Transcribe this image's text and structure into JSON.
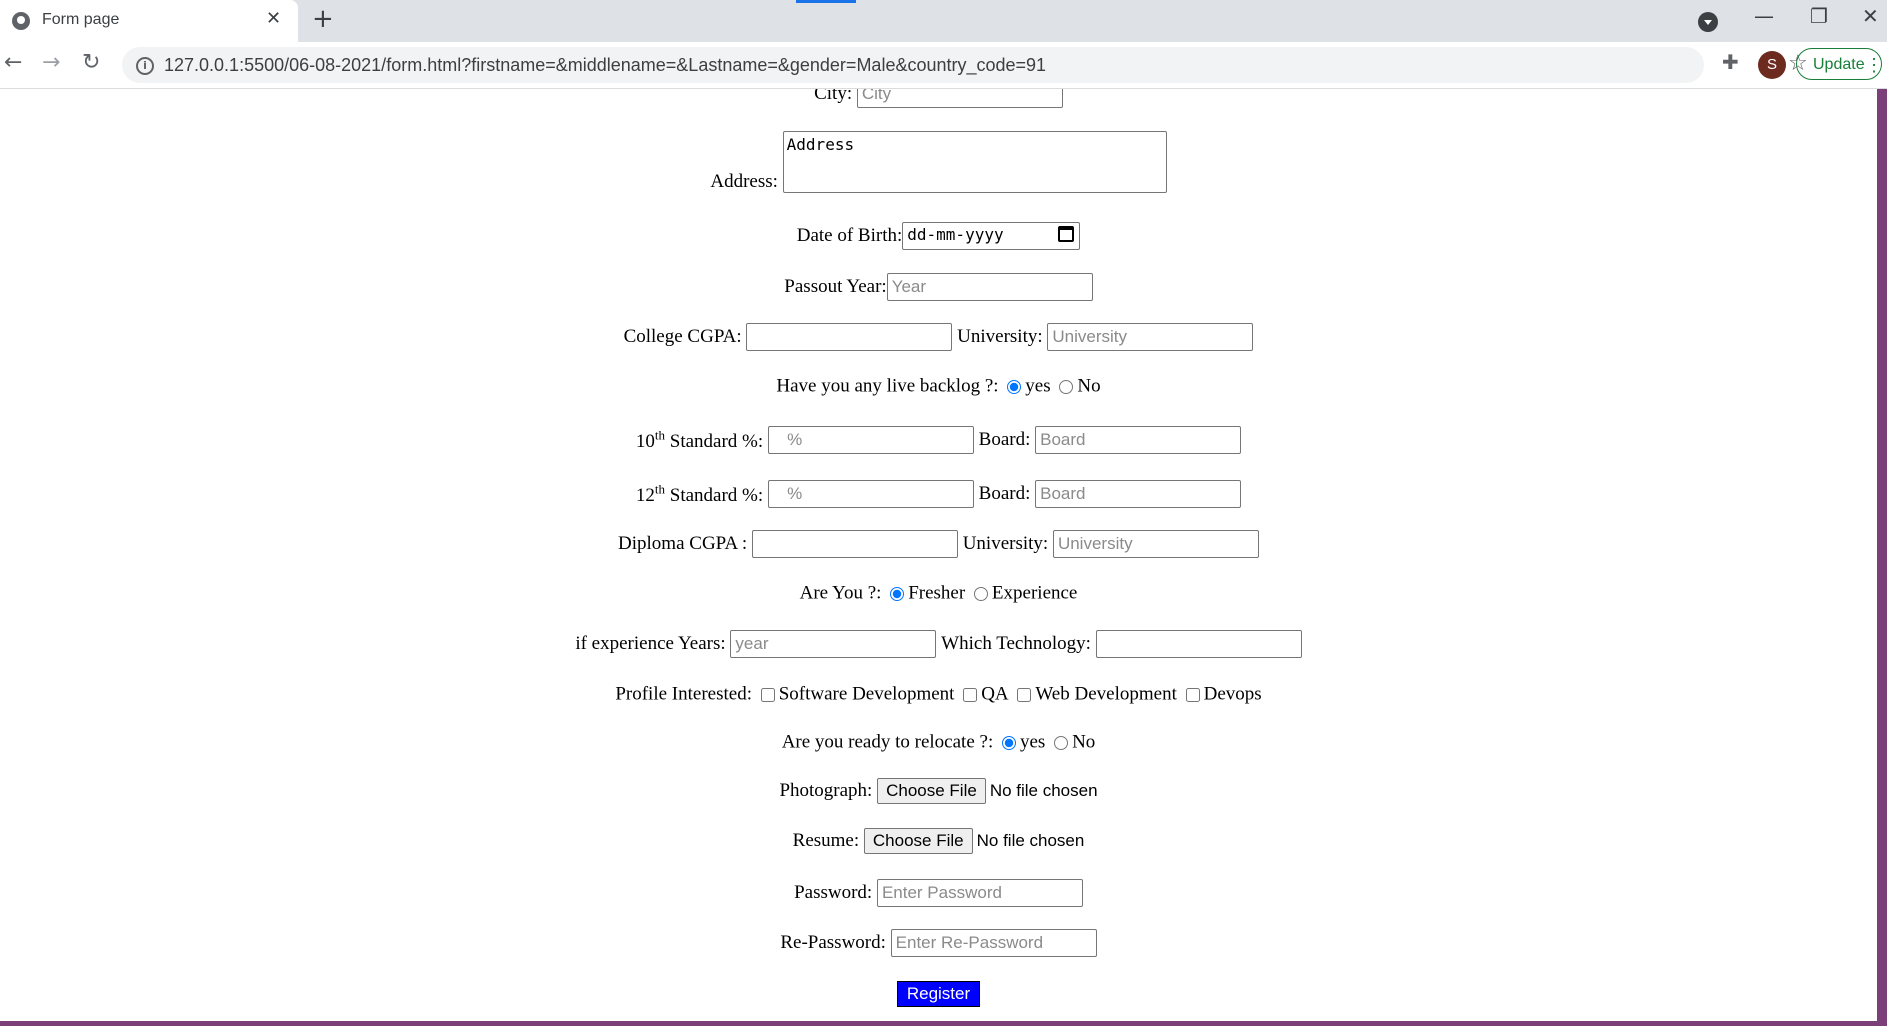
{
  "browser": {
    "tab_title": "Form page",
    "tab_close": "✕",
    "new_tab": "+",
    "url": "127.0.0.1:5500/06-08-2021/form.html?firstname=&middlename=&Lastname=&gender=Male&country_code=91",
    "profile_initial": "S",
    "update_label": "Update",
    "back": "←",
    "forward": "→",
    "reload": "↻",
    "star": "☆",
    "extensions": "✚",
    "minimize": "—",
    "restore": "❐",
    "close": "✕"
  },
  "form": {
    "city": {
      "label": "City:",
      "placeholder": "City"
    },
    "address": {
      "label": "Address:",
      "value": "Address"
    },
    "dob": {
      "label": "Date of Birth:",
      "value": "dd-mm-yyyy"
    },
    "passout": {
      "label": "Passout Year:",
      "placeholder": "Year"
    },
    "cgpa": {
      "label": "College CGPA:",
      "placeholder": ""
    },
    "university1": {
      "label": "University:",
      "placeholder": "University"
    },
    "backlog": {
      "label": "Have you any live backlog ?:",
      "yes": "yes",
      "no": "No",
      "selected": "yes"
    },
    "tenth": {
      "num": "10",
      "sup": "th",
      "label": "Standard %:",
      "placeholder": "   %",
      "board_label": "Board:",
      "board_placeholder": "Board"
    },
    "twelfth": {
      "num": "12",
      "sup": "th",
      "label": "Standard %:",
      "placeholder": "   %",
      "board_label": "Board:",
      "board_placeholder": "Board"
    },
    "diploma": {
      "label": "Diploma CGPA :",
      "placeholder": "",
      "university_label": "University:",
      "university_placeholder": "University"
    },
    "are_you": {
      "label": "Are You ?:",
      "fresher": "Fresher",
      "experience": "Experience",
      "selected": "Fresher"
    },
    "exp_years": {
      "label": "if experience Years:",
      "placeholder": "year",
      "tech_label": "Which Technology:",
      "tech_placeholder": ""
    },
    "profile": {
      "label": "Profile Interested:",
      "options": [
        "Software Development",
        "QA",
        "Web Development",
        "Devops"
      ]
    },
    "relocate": {
      "label": "Are you ready to relocate ?:",
      "yes": "yes",
      "no": "No",
      "selected": "yes"
    },
    "photograph": {
      "label": "Photograph:",
      "button": "Choose File",
      "status": "No file chosen"
    },
    "resume": {
      "label": "Resume:",
      "button": "Choose File",
      "status": "No file chosen"
    },
    "password": {
      "label": "Password:",
      "placeholder": "Enter Password"
    },
    "repassword": {
      "label": "Re-Password:",
      "placeholder": "Enter Re-Password"
    },
    "register": "Register"
  },
  "colors": {
    "accent_purple": "#7b3f7a",
    "register_bg": "#0000ff",
    "update_green": "#188038"
  }
}
